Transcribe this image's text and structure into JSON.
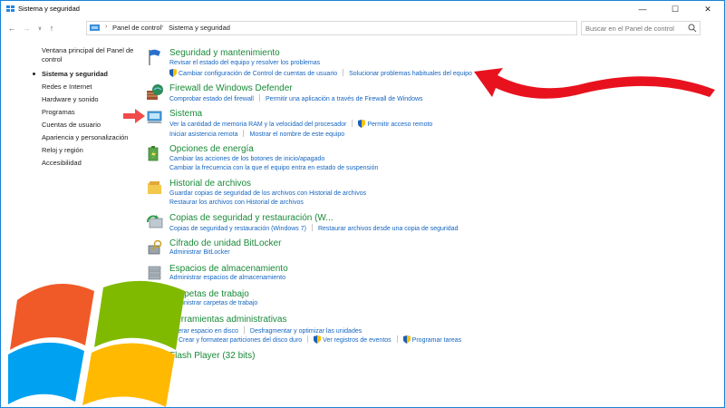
{
  "window": {
    "title": "Sistema y seguridad",
    "controls": {
      "minimize": "—",
      "maximize": "☐",
      "close": "✕"
    }
  },
  "address": {
    "crumbs": [
      "Panel de control",
      "Sistema y seguridad"
    ],
    "search_placeholder": "Buscar en el Panel de control"
  },
  "sidebar": {
    "items": [
      {
        "label": "Ventana principal del Panel de",
        "label2": "control"
      },
      {
        "label": "Sistema y seguridad"
      },
      {
        "label": "Redes e Internet"
      },
      {
        "label": "Hardware y sonido"
      },
      {
        "label": "Programas"
      },
      {
        "label": "Cuentas de usuario"
      },
      {
        "label": "Apariencia y personalización"
      },
      {
        "label": "Reloj y región"
      },
      {
        "label": "Accesibilidad"
      }
    ]
  },
  "categories": [
    {
      "title": "Seguridad y mantenimiento",
      "lines": [
        [
          "Revisar el estado del equipo y resolver los problemas"
        ],
        [
          "Cambiar configuración de Control de cuentas de usuario",
          "Solucionar problemas habituales del equipo"
        ]
      ]
    },
    {
      "title": "Firewall de Windows Defender",
      "lines": [
        [
          "Comprobar estado del firewall",
          "Permitir una aplicación a través de Firewall de Windows"
        ]
      ]
    },
    {
      "title": "Sistema",
      "lines": [
        [
          "Ver la cantidad de memoria RAM y la velocidad del procesador",
          "Permitir acceso remoto"
        ],
        [
          "Iniciar asistencia remota",
          "Mostrar el nombre de este equipo"
        ]
      ]
    },
    {
      "title": "Opciones de energía",
      "lines": [
        [
          "Cambiar las acciones de los botones de inicio/apagado"
        ],
        [
          "Cambiar la frecuencia con la que el equipo entra en estado de suspensión"
        ]
      ]
    },
    {
      "title": "Historial de archivos",
      "lines": [
        [
          "Guardar copias de seguridad de los archivos con Historial de archivos"
        ],
        [
          "Restaurar los archivos con Historial de archivos"
        ]
      ]
    },
    {
      "title": "Copias de seguridad y restauración (W...",
      "lines": [
        [
          "Copias de seguridad y restauración (Windows 7)",
          "Restaurar archivos desde una copia de seguridad"
        ]
      ]
    },
    {
      "title": "Cifrado de unidad BitLocker",
      "lines": [
        [
          "Administrar BitLocker"
        ]
      ]
    },
    {
      "title": "Espacios de almacenamiento",
      "lines": [
        [
          "Administrar espacios de almacenamiento"
        ]
      ]
    },
    {
      "title": "Carpetas de trabajo",
      "lines": [
        [
          "Administrar carpetas de trabajo"
        ]
      ]
    },
    {
      "title": "Herramientas administrativas",
      "lines": [
        [
          "Liberar espacio en disco",
          "Desfragmentar y optimizar las unidades"
        ],
        [
          "Crear y formatear particiones del disco duro",
          "Ver registros de eventos",
          "Programar tareas"
        ]
      ]
    },
    {
      "title": "Flash Player (32 bits)",
      "lines": []
    }
  ],
  "colors": {
    "category_title": "#1a8a38",
    "link": "#1565c0",
    "arrow": "#e8121e",
    "frame": "#1883d7"
  }
}
